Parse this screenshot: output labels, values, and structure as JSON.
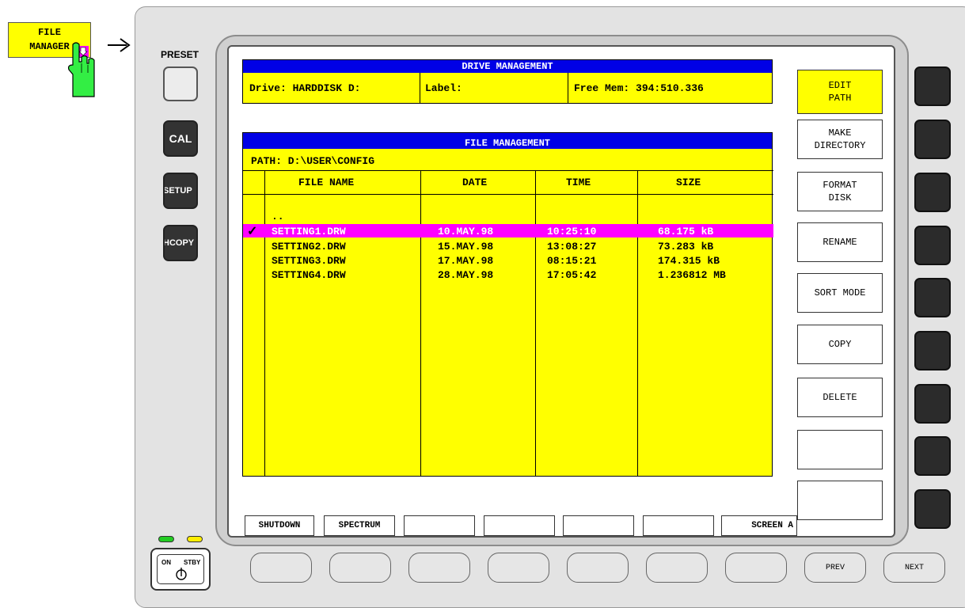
{
  "top_softkey": {
    "line1": "FILE",
    "line2": "MANAGER"
  },
  "left_panel": {
    "preset_label": "PRESET",
    "cal_label": "CAL",
    "setup_label": "SETUP",
    "hcopy_label": "HCOPY"
  },
  "power": {
    "on_label": "ON",
    "stby_label": "STBY"
  },
  "drive_management": {
    "title": "DRIVE MANAGEMENT",
    "drive": "Drive: HARDDISK D:",
    "label": "Label:",
    "free_mem": "Free Mem: 394:510.336"
  },
  "file_management": {
    "title": "FILE MANAGEMENT",
    "path": "PATH:  D:\\USER\\CONFIG",
    "columns": [
      "FILE NAME",
      "DATE",
      "TIME",
      "SIZE"
    ],
    "parent_dir": "..",
    "check_mark": "✓",
    "rows": [
      {
        "name": "SETTING1.DRW",
        "date": "10.MAY.98",
        "time": "10:25:10",
        "size": "68.175 kB",
        "selected": true
      },
      {
        "name": "SETTING2.DRW",
        "date": "15.MAY.98",
        "time": "13:08:27",
        "size": "73.283 kB",
        "selected": false
      },
      {
        "name": "SETTING3.DRW",
        "date": "17.MAY.98",
        "time": "08:15:21",
        "size": "174.315 kB",
        "selected": false
      },
      {
        "name": "SETTING4.DRW",
        "date": "28.MAY.98",
        "time": "17:05:42",
        "size": "1.236812 MB",
        "selected": false
      }
    ]
  },
  "softkeys": {
    "edit_path": {
      "line1": "EDIT",
      "line2": "PATH"
    },
    "make_directory": {
      "line1": "MAKE",
      "line2": "DIRECTORY"
    },
    "format_disk": {
      "line1": "FORMAT",
      "line2": "DISK"
    },
    "rename": "RENAME",
    "sort_mode": "SORT MODE",
    "copy": "COPY",
    "delete": "DELETE"
  },
  "bottom_softkeys": {
    "shutdown": "SHUTDOWN",
    "spectrum": "SPECTRUM",
    "screen_a": "SCREEN A"
  },
  "bottom_hardkeys": {
    "prev": "PREV",
    "next": "NEXT"
  },
  "colors": {
    "table_bg": "#ffff00",
    "title_bar": "#0000e6",
    "selection": "#ff00ff",
    "led_green": "#22cc22",
    "led_yellow": "#ffee00"
  }
}
